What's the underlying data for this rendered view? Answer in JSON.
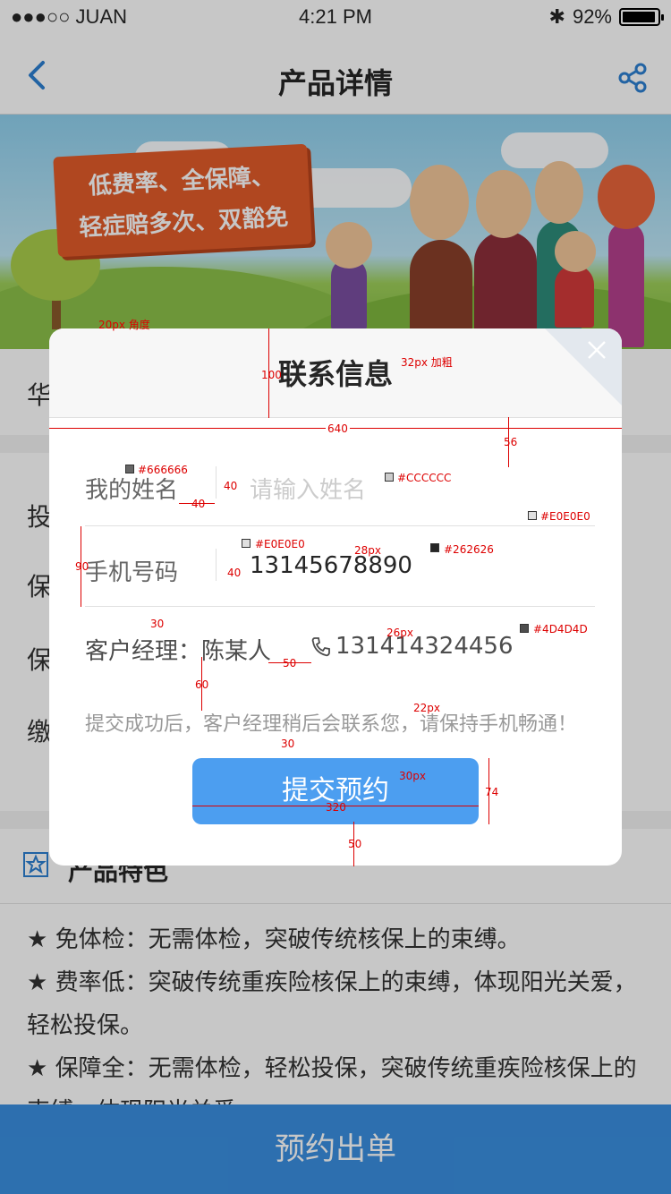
{
  "statusbar": {
    "carrier": "●●●○○ JUAN",
    "time": "4:21 PM",
    "battery_text": "92%"
  },
  "nav": {
    "title": "产品详情",
    "back_icon": "chevron-left-icon",
    "share_icon": "share-icon",
    "accent": "#2c7fd1"
  },
  "banner": {
    "slogan_line1": "低费率、全保障、",
    "slogan_line2": "轻症赔多次、双豁免"
  },
  "base": {
    "section_label": "华",
    "row_labels": [
      "投",
      "保",
      "保",
      "缴"
    ],
    "features_icon_label": "产品特色",
    "features": [
      "★  免体检：无需体检，突破传统核保上的束缚。",
      "★  费率低：突破传统重疾险核保上的束缚，体现阳光关爱，轻松投保。",
      "★  保障全：无需体检，轻松投保，突破传统重疾险核保上的束缚，体现阳光关爱。"
    ],
    "cta_label": "预约出单"
  },
  "modal": {
    "title": "联系信息",
    "name_label": "我的姓名",
    "name_placeholder": "请输入姓名",
    "phone_label": "手机号码",
    "phone_value": "13145678890",
    "manager_label": "客户经理：陈某人",
    "manager_phone": "131414324456",
    "note": "提交成功后，客户经理稍后会联系您，请保持手机畅通！",
    "submit_label": "提交预约",
    "close_icon": "close-icon",
    "phone_icon": "phone-icon"
  },
  "annotations": {
    "a1": "20px 角度",
    "a2": "32px 加粗",
    "a3": "100",
    "a4": "640",
    "a5": "56",
    "a6": "#666666",
    "a7": "40",
    "a8": "40",
    "a9": "#CCCCCC",
    "a10": "#E0E0E0",
    "a11": "#E0E0E0",
    "a12": "28px",
    "a13": "#262626",
    "a14": "90",
    "a15": "40",
    "a16": "30",
    "a17": "26px",
    "a18": "#4D4D4D",
    "a19": "50",
    "a20": "60",
    "a21": "22px",
    "a22": "30",
    "a23": "30px",
    "a24": "320",
    "a25": "74",
    "a26": "50"
  }
}
